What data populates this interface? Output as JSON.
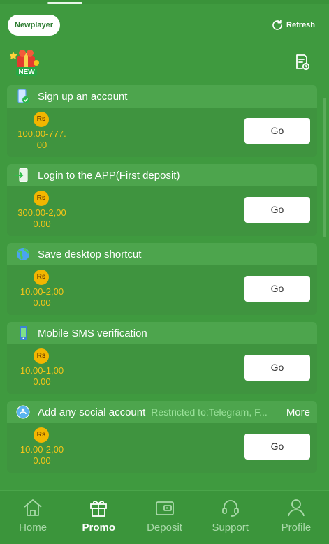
{
  "header": {
    "newplayer_label": "Newplayer",
    "refresh_label": "Refresh"
  },
  "tasks": [
    {
      "title": "Sign up an account",
      "currency": "Rs",
      "amount": "100.00-777.\n00",
      "button": "Go"
    },
    {
      "title": "Login to the APP(First deposit)",
      "currency": "Rs",
      "amount": "300.00-2,00\n0.00",
      "button": "Go"
    },
    {
      "title": "Save desktop shortcut",
      "currency": "Rs",
      "amount": "10.00-2,00\n0.00",
      "button": "Go"
    },
    {
      "title": "Mobile SMS verification",
      "currency": "Rs",
      "amount": "10.00-1,00\n0.00",
      "button": "Go"
    },
    {
      "title": "Add any social account",
      "restriction": "Restricted to:Telegram, F...",
      "more": "More",
      "currency": "Rs",
      "amount": "10.00-2,00\n0.00",
      "button": "Go"
    }
  ],
  "nav": [
    {
      "label": "Home"
    },
    {
      "label": "Promo"
    },
    {
      "label": "Deposit"
    },
    {
      "label": "Support"
    },
    {
      "label": "Profile"
    }
  ],
  "badge": {
    "text": "NEW"
  },
  "colors": {
    "background": "#3f9a3f",
    "accent_gold": "#f5c518",
    "card": "#3f943f"
  }
}
